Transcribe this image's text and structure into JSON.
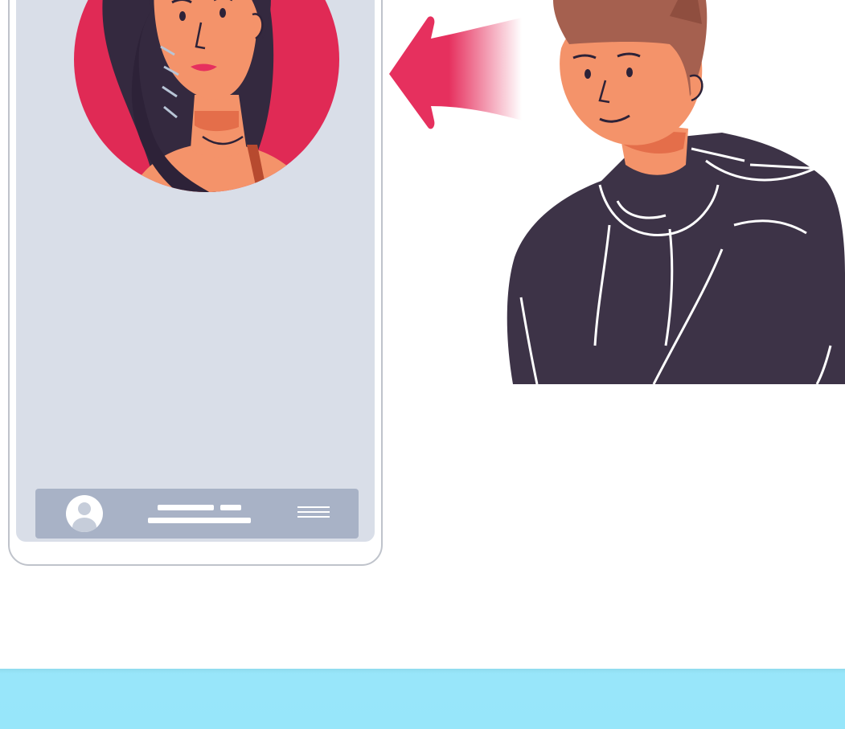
{
  "illustration": {
    "phone": {
      "screen_color": "#d9dee8",
      "bar_color": "#a8b2c6"
    },
    "portrait": {
      "background_color": "#e02a55",
      "subject": "woman-portrait"
    },
    "arrow": {
      "direction": "left",
      "color": "#e6305e"
    },
    "person": {
      "subject": "man-in-dark-hoodie",
      "hoodie_color": "#3d3347"
    }
  },
  "footer": {
    "color": "#98e6fa"
  },
  "icons": [
    "user-avatar-icon",
    "menu-lines-icon",
    "arrow-left-icon"
  ]
}
